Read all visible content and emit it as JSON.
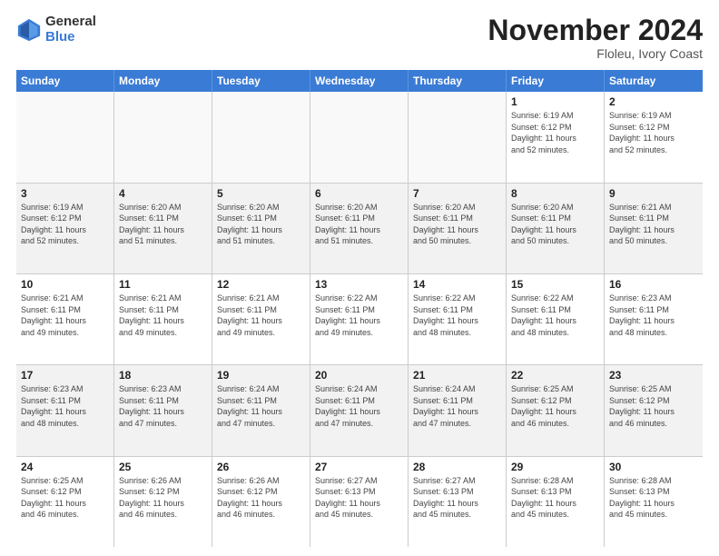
{
  "logo": {
    "general": "General",
    "blue": "Blue"
  },
  "title": "November 2024",
  "location": "Floleu, Ivory Coast",
  "header_days": [
    "Sunday",
    "Monday",
    "Tuesday",
    "Wednesday",
    "Thursday",
    "Friday",
    "Saturday"
  ],
  "weeks": [
    [
      {
        "day": "",
        "detail": ""
      },
      {
        "day": "",
        "detail": ""
      },
      {
        "day": "",
        "detail": ""
      },
      {
        "day": "",
        "detail": ""
      },
      {
        "day": "",
        "detail": ""
      },
      {
        "day": "1",
        "detail": "Sunrise: 6:19 AM\nSunset: 6:12 PM\nDaylight: 11 hours\nand 52 minutes."
      },
      {
        "day": "2",
        "detail": "Sunrise: 6:19 AM\nSunset: 6:12 PM\nDaylight: 11 hours\nand 52 minutes."
      }
    ],
    [
      {
        "day": "3",
        "detail": "Sunrise: 6:19 AM\nSunset: 6:12 PM\nDaylight: 11 hours\nand 52 minutes."
      },
      {
        "day": "4",
        "detail": "Sunrise: 6:20 AM\nSunset: 6:11 PM\nDaylight: 11 hours\nand 51 minutes."
      },
      {
        "day": "5",
        "detail": "Sunrise: 6:20 AM\nSunset: 6:11 PM\nDaylight: 11 hours\nand 51 minutes."
      },
      {
        "day": "6",
        "detail": "Sunrise: 6:20 AM\nSunset: 6:11 PM\nDaylight: 11 hours\nand 51 minutes."
      },
      {
        "day": "7",
        "detail": "Sunrise: 6:20 AM\nSunset: 6:11 PM\nDaylight: 11 hours\nand 50 minutes."
      },
      {
        "day": "8",
        "detail": "Sunrise: 6:20 AM\nSunset: 6:11 PM\nDaylight: 11 hours\nand 50 minutes."
      },
      {
        "day": "9",
        "detail": "Sunrise: 6:21 AM\nSunset: 6:11 PM\nDaylight: 11 hours\nand 50 minutes."
      }
    ],
    [
      {
        "day": "10",
        "detail": "Sunrise: 6:21 AM\nSunset: 6:11 PM\nDaylight: 11 hours\nand 49 minutes."
      },
      {
        "day": "11",
        "detail": "Sunrise: 6:21 AM\nSunset: 6:11 PM\nDaylight: 11 hours\nand 49 minutes."
      },
      {
        "day": "12",
        "detail": "Sunrise: 6:21 AM\nSunset: 6:11 PM\nDaylight: 11 hours\nand 49 minutes."
      },
      {
        "day": "13",
        "detail": "Sunrise: 6:22 AM\nSunset: 6:11 PM\nDaylight: 11 hours\nand 49 minutes."
      },
      {
        "day": "14",
        "detail": "Sunrise: 6:22 AM\nSunset: 6:11 PM\nDaylight: 11 hours\nand 48 minutes."
      },
      {
        "day": "15",
        "detail": "Sunrise: 6:22 AM\nSunset: 6:11 PM\nDaylight: 11 hours\nand 48 minutes."
      },
      {
        "day": "16",
        "detail": "Sunrise: 6:23 AM\nSunset: 6:11 PM\nDaylight: 11 hours\nand 48 minutes."
      }
    ],
    [
      {
        "day": "17",
        "detail": "Sunrise: 6:23 AM\nSunset: 6:11 PM\nDaylight: 11 hours\nand 48 minutes."
      },
      {
        "day": "18",
        "detail": "Sunrise: 6:23 AM\nSunset: 6:11 PM\nDaylight: 11 hours\nand 47 minutes."
      },
      {
        "day": "19",
        "detail": "Sunrise: 6:24 AM\nSunset: 6:11 PM\nDaylight: 11 hours\nand 47 minutes."
      },
      {
        "day": "20",
        "detail": "Sunrise: 6:24 AM\nSunset: 6:11 PM\nDaylight: 11 hours\nand 47 minutes."
      },
      {
        "day": "21",
        "detail": "Sunrise: 6:24 AM\nSunset: 6:11 PM\nDaylight: 11 hours\nand 47 minutes."
      },
      {
        "day": "22",
        "detail": "Sunrise: 6:25 AM\nSunset: 6:12 PM\nDaylight: 11 hours\nand 46 minutes."
      },
      {
        "day": "23",
        "detail": "Sunrise: 6:25 AM\nSunset: 6:12 PM\nDaylight: 11 hours\nand 46 minutes."
      }
    ],
    [
      {
        "day": "24",
        "detail": "Sunrise: 6:25 AM\nSunset: 6:12 PM\nDaylight: 11 hours\nand 46 minutes."
      },
      {
        "day": "25",
        "detail": "Sunrise: 6:26 AM\nSunset: 6:12 PM\nDaylight: 11 hours\nand 46 minutes."
      },
      {
        "day": "26",
        "detail": "Sunrise: 6:26 AM\nSunset: 6:12 PM\nDaylight: 11 hours\nand 46 minutes."
      },
      {
        "day": "27",
        "detail": "Sunrise: 6:27 AM\nSunset: 6:13 PM\nDaylight: 11 hours\nand 45 minutes."
      },
      {
        "day": "28",
        "detail": "Sunrise: 6:27 AM\nSunset: 6:13 PM\nDaylight: 11 hours\nand 45 minutes."
      },
      {
        "day": "29",
        "detail": "Sunrise: 6:28 AM\nSunset: 6:13 PM\nDaylight: 11 hours\nand 45 minutes."
      },
      {
        "day": "30",
        "detail": "Sunrise: 6:28 AM\nSunset: 6:13 PM\nDaylight: 11 hours\nand 45 minutes."
      }
    ]
  ]
}
